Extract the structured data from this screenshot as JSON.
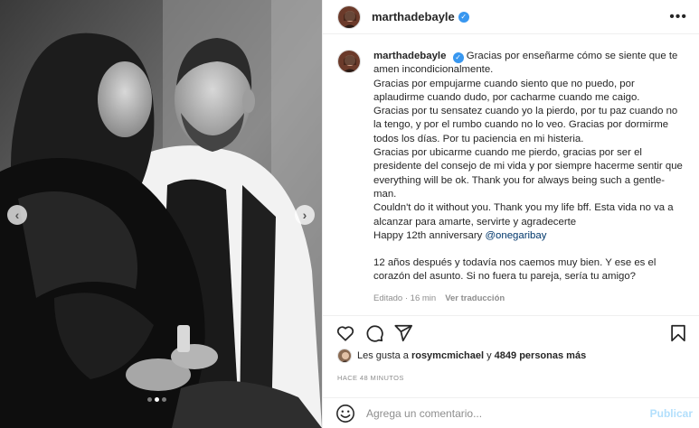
{
  "post": {
    "username": "marthadebayle",
    "verified": true,
    "more_icon": "more-horizontal-icon",
    "caption_lines": [
      "Gracias por enseñarme cómo se siente que te amen incondicionalmente.",
      "Gracias por empujarme cuando siento que no puedo, por aplaudirme cuando dudo, por cacharme cuando me caigo.",
      "Gracias por tu sensatez cuando yo la pierdo, por tu paz cuando no la tengo, y por el rumbo cuando no lo veo. Gracias por dormirme todos los días. Por tu paciencia en mi histeria.",
      "Gracias por ubicarme cuando me pierdo, gracias por ser el presidente del consejo de mi vida y por siempre hacerme sentir que everything will be ok. Thank you for always being such a gentle-man.",
      "Couldn't do it without you. Thank you my life bff. Esta vida no va a alcanzar para amarte, servirte y agradecerte"
    ],
    "anniversary_text": "Happy 12th anniversary",
    "mention": "@onegaribay",
    "closing_text": "12 años después y todavía nos caemos muy bien. Y ese es el corazón del asunto. Si no fuera tu pareja, sería tu amigo?",
    "edited_label": "Editado · 16 min",
    "translate_label": "Ver traducción"
  },
  "actions": {
    "like_icon": "heart-icon",
    "comment_icon": "comment-icon",
    "share_icon": "share-icon",
    "save_icon": "bookmark-icon"
  },
  "likes": {
    "prefix": "Les gusta a",
    "first_user": "rosymcmichael",
    "connector": "y",
    "count_text": "4849 personas más"
  },
  "timestamp": "HACE 48 MINUTOS",
  "comment": {
    "emoji_icon": "emoji-icon",
    "placeholder": "Agrega un comentario...",
    "publish_label": "Publicar"
  },
  "carousel": {
    "total": 3,
    "active_index": 1,
    "prev_icon": "chevron-left-icon",
    "next_icon": "chevron-right-icon"
  }
}
